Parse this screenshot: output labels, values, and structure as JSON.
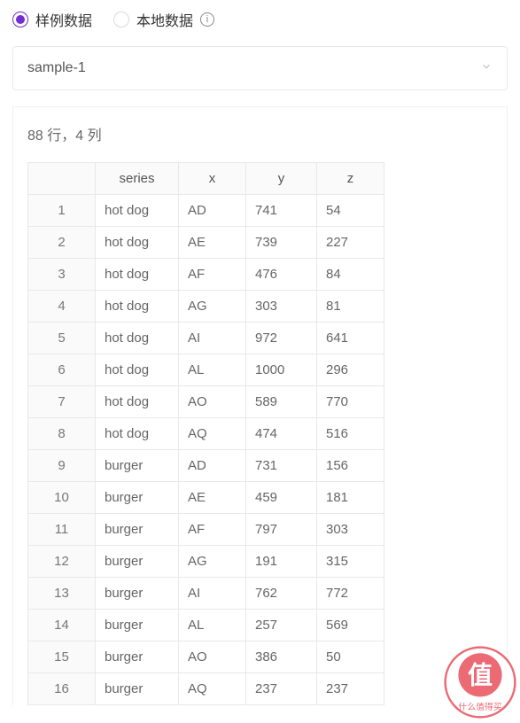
{
  "radio": {
    "sample_label": "样例数据",
    "local_label": "本地数据"
  },
  "select": {
    "value": "sample-1"
  },
  "summary": "88 行，4 列",
  "columns": {
    "series": "series",
    "x": "x",
    "y": "y",
    "z": "z"
  },
  "rows": [
    {
      "idx": "1",
      "series": "hot dog",
      "x": "AD",
      "y": "741",
      "z": "54"
    },
    {
      "idx": "2",
      "series": "hot dog",
      "x": "AE",
      "y": "739",
      "z": "227"
    },
    {
      "idx": "3",
      "series": "hot dog",
      "x": "AF",
      "y": "476",
      "z": "84"
    },
    {
      "idx": "4",
      "series": "hot dog",
      "x": "AG",
      "y": "303",
      "z": "81"
    },
    {
      "idx": "5",
      "series": "hot dog",
      "x": "AI",
      "y": "972",
      "z": "641"
    },
    {
      "idx": "6",
      "series": "hot dog",
      "x": "AL",
      "y": "1000",
      "z": "296"
    },
    {
      "idx": "7",
      "series": "hot dog",
      "x": "AO",
      "y": "589",
      "z": "770"
    },
    {
      "idx": "8",
      "series": "hot dog",
      "x": "AQ",
      "y": "474",
      "z": "516"
    },
    {
      "idx": "9",
      "series": "burger",
      "x": "AD",
      "y": "731",
      "z": "156"
    },
    {
      "idx": "10",
      "series": "burger",
      "x": "AE",
      "y": "459",
      "z": "181"
    },
    {
      "idx": "11",
      "series": "burger",
      "x": "AF",
      "y": "797",
      "z": "303"
    },
    {
      "idx": "12",
      "series": "burger",
      "x": "AG",
      "y": "191",
      "z": "315"
    },
    {
      "idx": "13",
      "series": "burger",
      "x": "AI",
      "y": "762",
      "z": "772"
    },
    {
      "idx": "14",
      "series": "burger",
      "x": "AL",
      "y": "257",
      "z": "569"
    },
    {
      "idx": "15",
      "series": "burger",
      "x": "AO",
      "y": "386",
      "z": "50"
    },
    {
      "idx": "16",
      "series": "burger",
      "x": "AQ",
      "y": "237",
      "z": "237"
    }
  ],
  "watermark": {
    "top": "值",
    "bottom": "什么值得买"
  }
}
